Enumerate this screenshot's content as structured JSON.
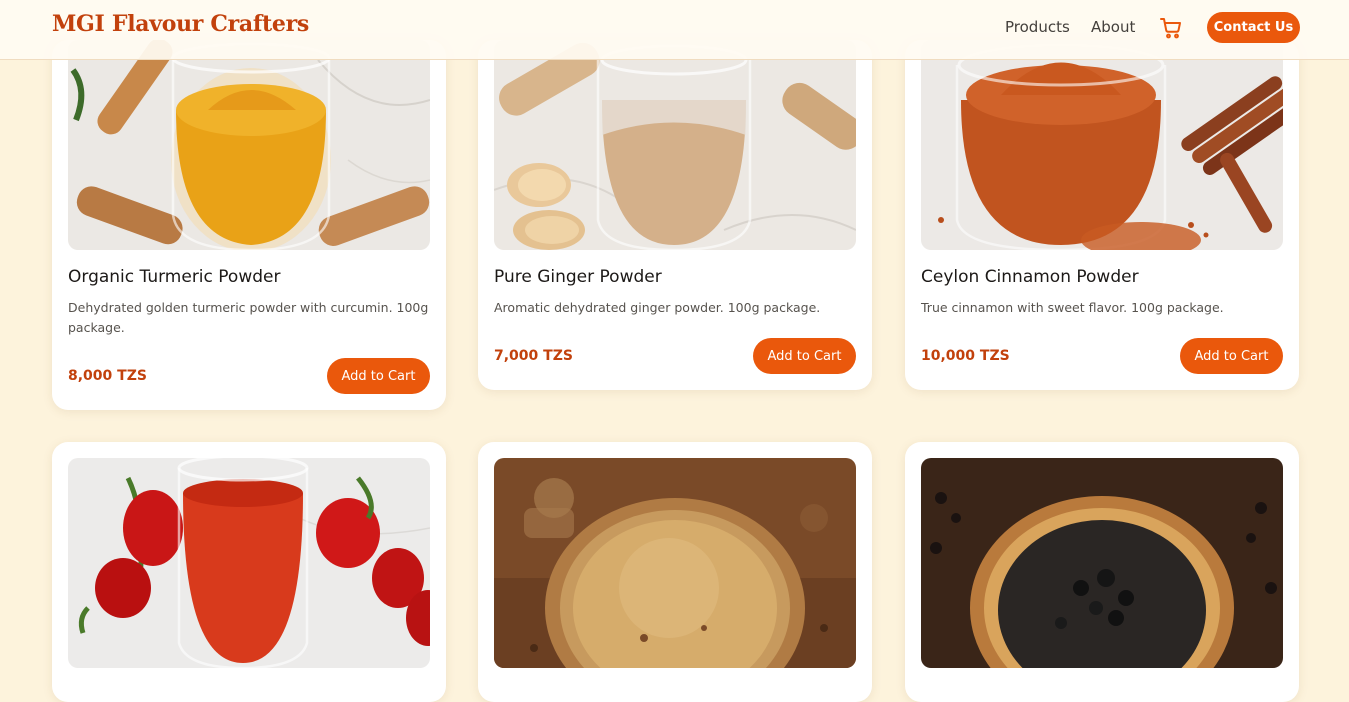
{
  "brand": "MGI Flavour Crafters",
  "nav": {
    "products": "Products",
    "about": "About",
    "cart_icon": "cart-icon",
    "contact": "Contact Us"
  },
  "colors": {
    "accent": "#ea580c",
    "brand": "#c2410c",
    "background": "#fdf3dc"
  },
  "products": [
    {
      "name": "Organic Turmeric Powder",
      "description": "Dehydrated golden turmeric powder with curcumin. 100g package.",
      "price": "8,000 TZS",
      "button": "Add to Cart",
      "image": "turmeric-jar-photo"
    },
    {
      "name": "Pure Ginger Powder",
      "description": "Aromatic dehydrated ginger powder. 100g package.",
      "price": "7,000 TZS",
      "button": "Add to Cart",
      "image": "ginger-jar-photo"
    },
    {
      "name": "Ceylon Cinnamon Powder",
      "description": "True cinnamon with sweet flavor. 100g package.",
      "price": "10,000 TZS",
      "button": "Add to Cart",
      "image": "cinnamon-jar-photo"
    },
    {
      "image": "chili-jar-photo"
    },
    {
      "image": "spice-powder-bowl-photo"
    },
    {
      "image": "black-pepper-bowl-photo"
    }
  ]
}
